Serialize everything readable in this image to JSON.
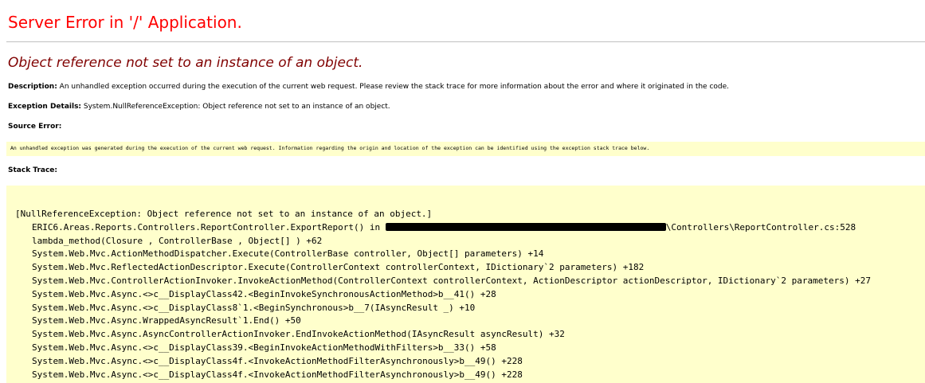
{
  "header": {
    "title": "Server Error in '/' Application.",
    "error_message": "Object reference not set to an instance of an object."
  },
  "description": {
    "label": "Description:",
    "text": " An unhandled exception occurred during the execution of the current web request. Please review the stack trace for more information about the error and where it originated in the code."
  },
  "exception_details": {
    "label": "Exception Details:",
    "text": " System.NullReferenceException: Object reference not set to an instance of an object."
  },
  "source_error": {
    "label": "Source Error:",
    "text": "An unhandled exception was generated during the execution of the current web request. Information regarding the origin and location of the exception can be identified using the exception stack trace below."
  },
  "stack_trace": {
    "label": "Stack Trace:",
    "header_line": "[NullReferenceException: Object reference not set to an instance of an object.]",
    "first_frame_prefix": "ERIC6.Areas.Reports.Controllers.ReportController.ExportReport() in ",
    "first_frame_suffix": "\\Controllers\\ReportController.cs:528",
    "frames": [
      "lambda_method(Closure , ControllerBase , Object[] ) +62",
      "System.Web.Mvc.ActionMethodDispatcher.Execute(ControllerBase controller, Object[] parameters) +14",
      "System.Web.Mvc.ReflectedActionDescriptor.Execute(ControllerContext controllerContext, IDictionary`2 parameters) +182",
      "System.Web.Mvc.ControllerActionInvoker.InvokeActionMethod(ControllerContext controllerContext, ActionDescriptor actionDescriptor, IDictionary`2 parameters) +27",
      "System.Web.Mvc.Async.<>c__DisplayClass42.<BeginInvokeSynchronousActionMethod>b__41() +28",
      "System.Web.Mvc.Async.<>c__DisplayClass8`1.<BeginSynchronous>b__7(IAsyncResult _) +10",
      "System.Web.Mvc.Async.WrappedAsyncResult`1.End() +50",
      "System.Web.Mvc.Async.AsyncControllerActionInvoker.EndInvokeActionMethod(IAsyncResult asyncResult) +32",
      "System.Web.Mvc.Async.<>c__DisplayClass39.<BeginInvokeActionMethodWithFilters>b__33() +58",
      "System.Web.Mvc.Async.<>c__DisplayClass4f.<InvokeActionMethodFilterAsynchronously>b__49() +228",
      "System.Web.Mvc.Async.<>c__DisplayClass4f.<InvokeActionMethodFilterAsynchronously>b__49() +228"
    ]
  },
  "colors": {
    "title": "#ff0000",
    "error_message": "#800000",
    "code_background": "#ffffcc",
    "rule": "#c0c0c0"
  }
}
